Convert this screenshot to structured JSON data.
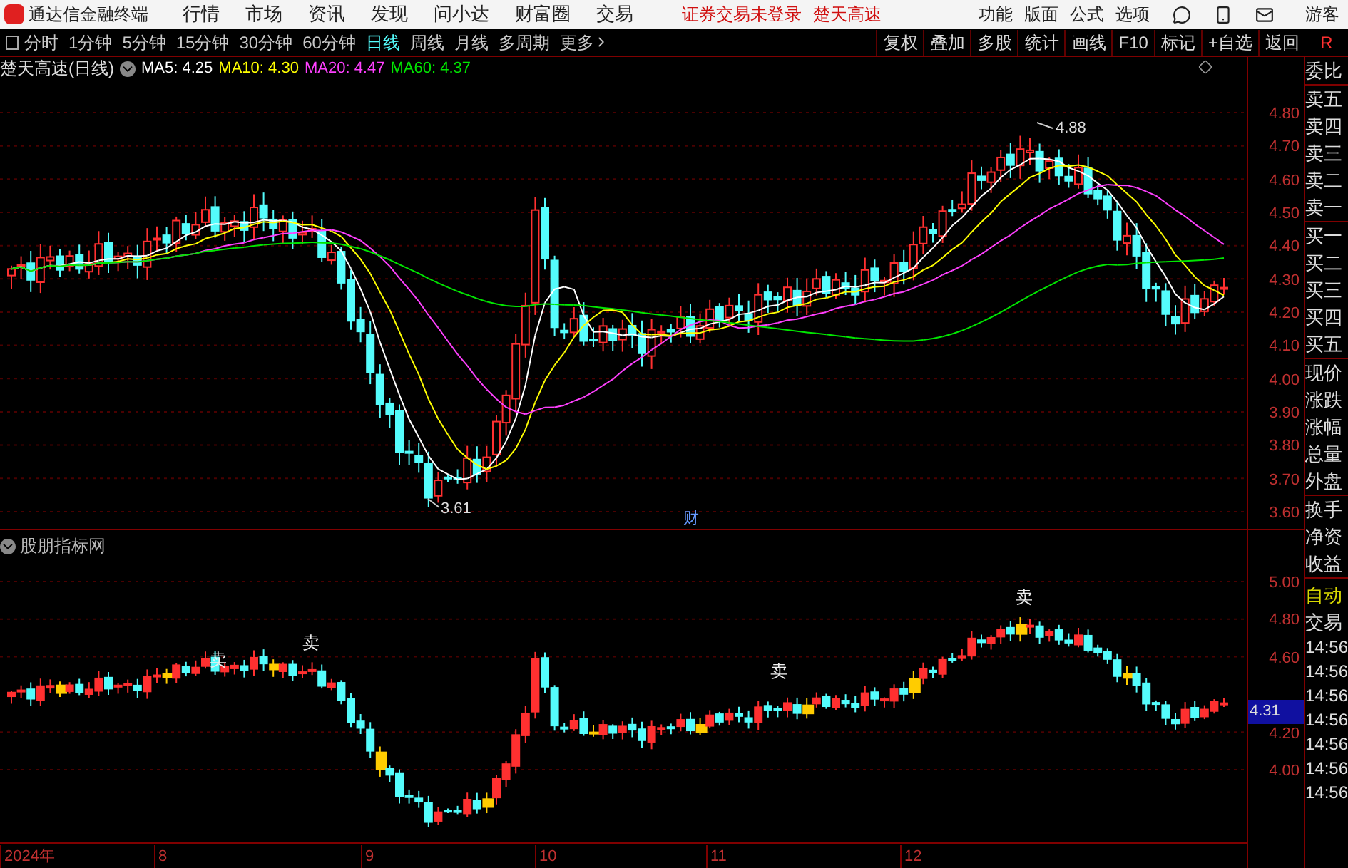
{
  "title_bar": {
    "app_name": "通达信金融终端",
    "menu": [
      "行情",
      "市场",
      "资讯",
      "发现",
      "问小达",
      "财富圈",
      "交易"
    ],
    "notices": [
      "证券交易未登录",
      "楚天高速"
    ],
    "right_menu": [
      "功能",
      "版面",
      "公式",
      "选项"
    ],
    "user": "游客"
  },
  "toolbar": {
    "periods": [
      {
        "label": "分时",
        "selected": false
      },
      {
        "label": "1分钟",
        "selected": false
      },
      {
        "label": "5分钟",
        "selected": false
      },
      {
        "label": "15分钟",
        "selected": false
      },
      {
        "label": "30分钟",
        "selected": false
      },
      {
        "label": "60分钟",
        "selected": false
      },
      {
        "label": "日线",
        "selected": true
      },
      {
        "label": "周线",
        "selected": false
      },
      {
        "label": "月线",
        "selected": false
      },
      {
        "label": "多周期",
        "selected": false
      }
    ],
    "more": "更多",
    "buttons": [
      "复权",
      "叠加",
      "多股",
      "统计",
      "画线",
      "F10",
      "标记",
      "+自选",
      "返回"
    ],
    "corner": "R"
  },
  "price_chart": {
    "title": "楚天高速(日线)",
    "moving_averages": [
      {
        "label": "MA5:",
        "value": "4.25",
        "color": "#ffffff"
      },
      {
        "label": "MA10:",
        "value": "4.30",
        "color": "#ffff00"
      },
      {
        "label": "MA20:",
        "value": "4.47",
        "color": "#ff40ff"
      },
      {
        "label": "MA60:",
        "value": "4.37",
        "color": "#00e600"
      }
    ],
    "axis_labels": [
      "4.80",
      "4.70",
      "4.60",
      "4.50",
      "4.40",
      "4.30",
      "4.20",
      "4.10",
      "4.00",
      "3.90",
      "3.80",
      "3.70",
      "3.60"
    ],
    "high_label": "4.88",
    "low_label": "3.61",
    "event_mark": "财"
  },
  "indicator": {
    "title": "股朋指标网",
    "signals": [
      "卖",
      "卖",
      "卖",
      "卖"
    ],
    "axis_labels": [
      "5.00",
      "4.80",
      "4.60",
      "4.20",
      "4.00"
    ],
    "current_value": "4.31"
  },
  "date_axis": [
    "2024年",
    "8",
    "9",
    "10",
    "11",
    "12"
  ],
  "side_panel": {
    "groups": [
      [
        "委比"
      ],
      [
        "卖五",
        "卖四",
        "卖三",
        "卖二",
        "卖一"
      ],
      [
        "买一",
        "买二",
        "买三",
        "买四",
        "买五"
      ],
      [
        "现价",
        "涨跌",
        "涨幅",
        "总量",
        "外盘"
      ],
      [
        "换手",
        "净资",
        "收益"
      ]
    ],
    "mode": "自动",
    "trade_header": "交易",
    "times": [
      "14:56",
      "14:56",
      "14:56",
      "14:56",
      "14:56",
      "14:56",
      "14:56"
    ]
  }
}
